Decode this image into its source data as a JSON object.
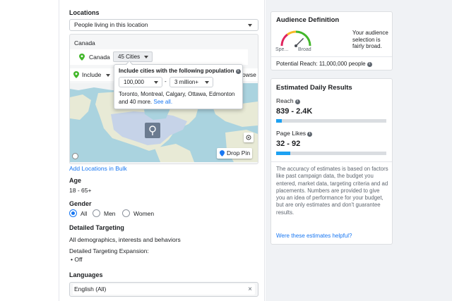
{
  "locations": {
    "label": "Locations",
    "mode_value": "People living in this location",
    "country_header": "Canada",
    "country_chip": "Canada",
    "cities_button": "45 Cities",
    "include_label": "Include",
    "browse_label": "owse",
    "drop_pin_label": "Drop Pin",
    "add_bulk_link": "Add Locations in Bulk",
    "popup": {
      "title": "Include cities with the following population",
      "min_value": "100,000",
      "separator": "-",
      "max_value": "3 million+",
      "cities_text": "Toronto, Montreal, Calgary, Ottawa, Edmonton and 40 more.",
      "see_all": "See all."
    }
  },
  "age": {
    "label": "Age",
    "value": "18 - 65+"
  },
  "gender": {
    "label": "Gender",
    "options": [
      {
        "label": "All",
        "selected": true
      },
      {
        "label": "Men",
        "selected": false
      },
      {
        "label": "Women",
        "selected": false
      }
    ]
  },
  "detailed_targeting": {
    "label": "Detailed Targeting",
    "value": "All demographics, interests and behaviors",
    "expansion_label": "Detailed Targeting Expansion:",
    "expansion_value": "• Off"
  },
  "languages": {
    "label": "Languages",
    "value": "English (All)"
  },
  "audience": {
    "title": "Audience Definition",
    "gauge_left": "Spe...",
    "gauge_right": "Broad",
    "summary": "Your audience selection is fairly broad.",
    "potential_reach": "Potential Reach: 11,000,000 people",
    "gauge_level": 0.75
  },
  "estimates": {
    "title": "Estimated Daily Results",
    "reach_label": "Reach",
    "reach_value": "839 - 2.4K",
    "reach_fraction": 0.05,
    "likes_label": "Page Likes",
    "likes_value": "32 - 92",
    "likes_fraction": 0.13,
    "disclaimer": "The accuracy of estimates is based on factors like past campaign data, the budget you entered, market data, targeting criteria and ad placements. Numbers are provided to give you an idea of performance for your budget, but are only estimates and don't guarantee results.",
    "helpful_link": "Were these estimates helpful?"
  },
  "colors": {
    "accent": "#1877f2",
    "bar": "#1da1f2",
    "green": "#42b72a"
  }
}
